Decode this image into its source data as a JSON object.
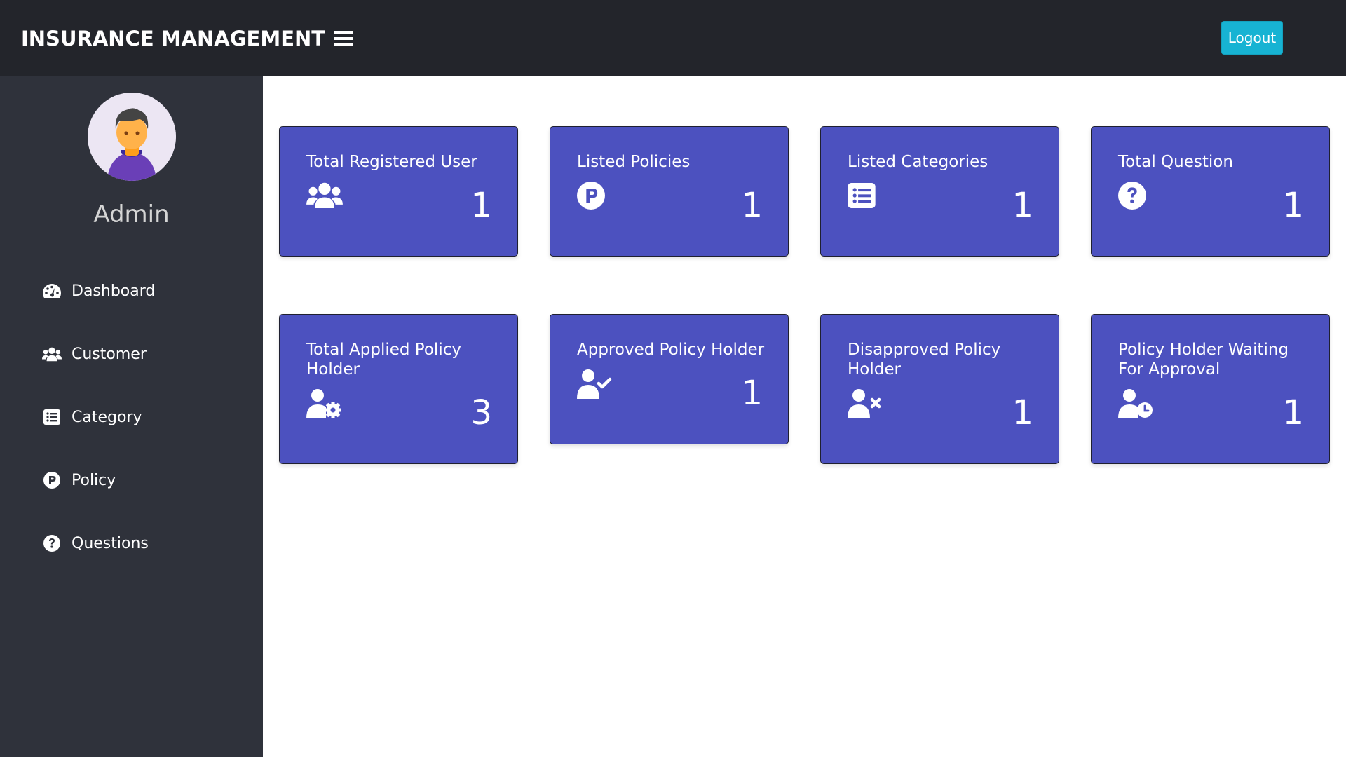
{
  "header": {
    "brand": "INSURANCE MANAGEMENT",
    "menu_icon": "hamburger-icon",
    "logout_label": "Logout"
  },
  "sidebar": {
    "user_name": "Admin",
    "avatar_icon": "user-avatar",
    "items": [
      {
        "label": "Dashboard",
        "icon": "tachometer-icon"
      },
      {
        "label": "Customer",
        "icon": "users-icon"
      },
      {
        "label": "Category",
        "icon": "list-icon"
      },
      {
        "label": "Policy",
        "icon": "parking-circle-icon"
      },
      {
        "label": "Questions",
        "icon": "question-circle-icon"
      }
    ]
  },
  "cards": [
    {
      "title": "Total Registered User",
      "value": "1",
      "icon": "users-icon"
    },
    {
      "title": "Listed Policies",
      "value": "1",
      "icon": "parking-circle-icon"
    },
    {
      "title": "Listed Categories",
      "value": "1",
      "icon": "list-icon"
    },
    {
      "title": "Total Question",
      "value": "1",
      "icon": "question-circle-icon"
    },
    {
      "title": "Total Applied Policy Holder",
      "value": "3",
      "icon": "user-cog-icon"
    },
    {
      "title": "Approved Policy Holder",
      "value": "1",
      "icon": "user-check-icon"
    },
    {
      "title": "Disapproved Policy Holder",
      "value": "1",
      "icon": "user-times-icon"
    },
    {
      "title": "Policy Holder Waiting For Approval",
      "value": "1",
      "icon": "user-clock-icon"
    }
  ],
  "colors": {
    "header_bg": "#23252b",
    "sidebar_bg": "#2f323b",
    "card_bg": "#4c51bf",
    "logout_bg": "#17b3d3"
  }
}
